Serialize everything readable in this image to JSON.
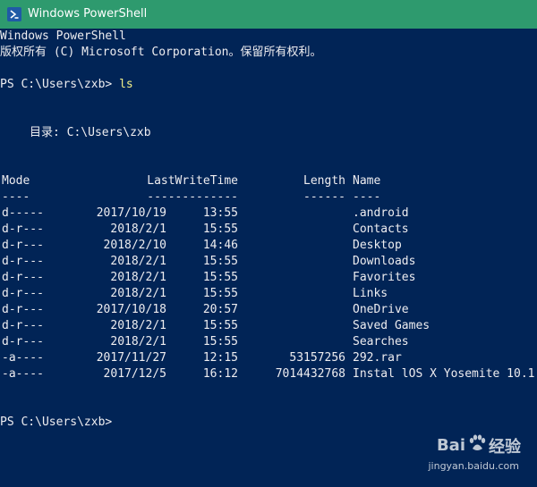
{
  "window": {
    "title": "Windows PowerShell",
    "icon": "powershell-icon"
  },
  "console": {
    "header_line1": "Windows PowerShell",
    "header_line2": "版权所有 (C) Microsoft Corporation。保留所有权利。",
    "prompt1": "PS C:\\Users\\zxb> ",
    "command1": "ls",
    "directory_line": "目录: C:\\Users\\zxb",
    "columns": {
      "mode": "Mode",
      "lastwritetime": "LastWriteTime",
      "length": "Length",
      "name": "Name"
    },
    "underlines": {
      "mode": "----",
      "lastwritetime": "-------------",
      "length": "------",
      "name": "----"
    },
    "rows": [
      {
        "mode": "d-----",
        "date": "2017/10/19",
        "time": "13:55",
        "length": "",
        "name": ".android"
      },
      {
        "mode": "d-r---",
        "date": "2018/2/1",
        "time": "15:55",
        "length": "",
        "name": "Contacts"
      },
      {
        "mode": "d-r---",
        "date": "2018/2/10",
        "time": "14:46",
        "length": "",
        "name": "Desktop"
      },
      {
        "mode": "d-r---",
        "date": "2018/2/1",
        "time": "15:55",
        "length": "",
        "name": "Downloads"
      },
      {
        "mode": "d-r---",
        "date": "2018/2/1",
        "time": "15:55",
        "length": "",
        "name": "Favorites"
      },
      {
        "mode": "d-r---",
        "date": "2018/2/1",
        "time": "15:55",
        "length": "",
        "name": "Links"
      },
      {
        "mode": "d-r---",
        "date": "2017/10/18",
        "time": "20:57",
        "length": "",
        "name": "OneDrive"
      },
      {
        "mode": "d-r---",
        "date": "2018/2/1",
        "time": "15:55",
        "length": "",
        "name": "Saved Games"
      },
      {
        "mode": "d-r---",
        "date": "2018/2/1",
        "time": "15:55",
        "length": "",
        "name": "Searches"
      },
      {
        "mode": "-a----",
        "date": "2017/11/27",
        "time": "12:15",
        "length": "53157256",
        "name": "292.rar"
      },
      {
        "mode": "-a----",
        "date": "2017/12/5",
        "time": "16:12",
        "length": "7014432768",
        "name": "Instal lOS X Yosemite 10.1"
      }
    ],
    "prompt2": "PS C:\\Users\\zxb>"
  },
  "watermark": {
    "brand_left": "Bai",
    "brand_right": "经验",
    "url": "jingyan.baidu.com"
  },
  "colors": {
    "titlebar": "#2e9a6e",
    "console_bg": "#012456",
    "console_fg": "#eeedf0",
    "command": "#f4f088"
  }
}
